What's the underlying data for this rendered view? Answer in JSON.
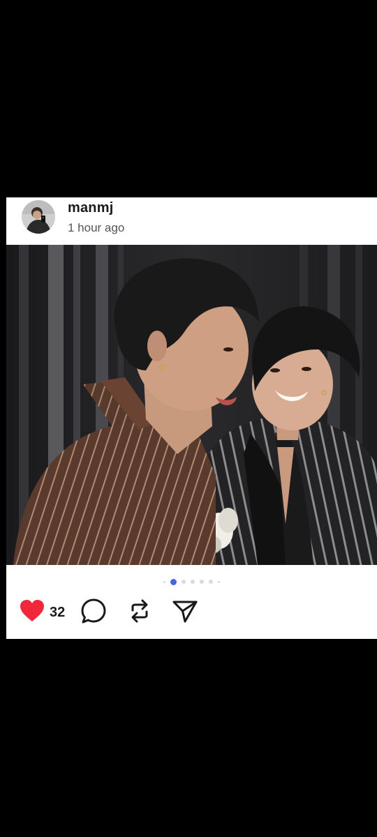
{
  "post": {
    "username": "manmj",
    "timestamp": "1 hour ago",
    "like_count": "32",
    "carousel": {
      "total_dots": 7,
      "active_index": 1
    }
  },
  "icons": {
    "like": "heart-icon",
    "comment": "comment-icon",
    "repost": "repost-icon",
    "share": "send-icon"
  },
  "colors": {
    "like": "#f0283c",
    "active_dot": "#4a63e6",
    "inactive_dot": "#d9d9e3"
  }
}
